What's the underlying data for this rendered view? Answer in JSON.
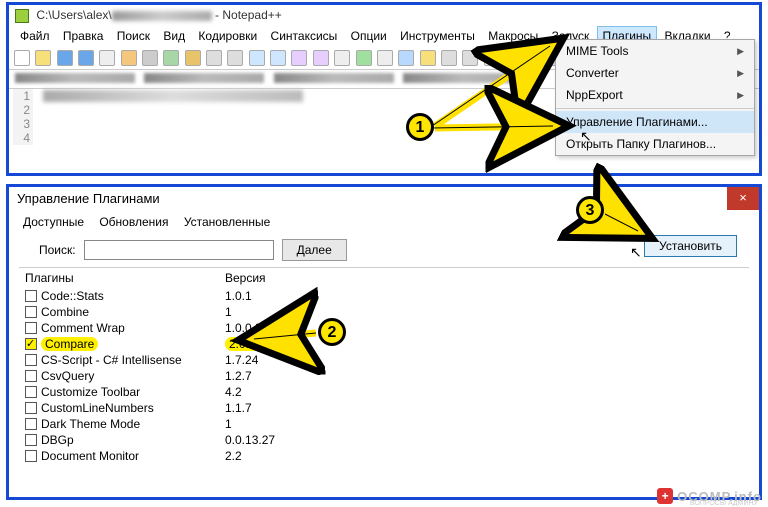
{
  "window": {
    "title_prefix": "C:\\Users\\alex\\",
    "title_suffix": " - Notepad++"
  },
  "menubar": [
    "Файл",
    "Правка",
    "Поиск",
    "Вид",
    "Кодировки",
    "Синтаксисы",
    "Опции",
    "Инструменты",
    "Макросы",
    "Запуск",
    "Плагины",
    "Вкладки",
    "?"
  ],
  "menubar_highlight_index": 10,
  "gutter_lines": [
    "1",
    "2",
    "3",
    "4"
  ],
  "dropdown": {
    "items": [
      "MIME Tools",
      "Converter",
      "NppExport"
    ],
    "sep_after": 2,
    "items2": [
      "Управление Плагинами...",
      "Открыть Папку Плагинов..."
    ],
    "highlight": "Управление Плагинами..."
  },
  "plugin_manager": {
    "title": "Управление Плагинами",
    "tabs": [
      "Доступные",
      "Обновления",
      "Установленные"
    ],
    "search_label": "Поиск:",
    "next_button": "Далее",
    "install_button": "Установить",
    "columns": [
      "Плагины",
      "Версия"
    ],
    "rows": [
      {
        "name": "Code::Stats",
        "ver": "1.0.1",
        "checked": false
      },
      {
        "name": "Combine",
        "ver": "1",
        "checked": false
      },
      {
        "name": "Comment Wrap",
        "ver": "1.0.0.3",
        "checked": false
      },
      {
        "name": "Compare",
        "ver": "2.0.1",
        "checked": true,
        "highlight": true
      },
      {
        "name": "CS-Script - C# Intellisense",
        "ver": "1.7.24",
        "checked": false
      },
      {
        "name": "CsvQuery",
        "ver": "1.2.7",
        "checked": false
      },
      {
        "name": "Customize Toolbar",
        "ver": "4.2",
        "checked": false
      },
      {
        "name": "CustomLineNumbers",
        "ver": "1.1.7",
        "checked": false
      },
      {
        "name": "Dark Theme Mode",
        "ver": "1",
        "checked": false
      },
      {
        "name": "DBGp",
        "ver": "0.0.13.27",
        "checked": false
      },
      {
        "name": "Document Monitor",
        "ver": "2.2",
        "checked": false
      }
    ]
  },
  "badges": {
    "b1": "1",
    "b2": "2",
    "b3": "3"
  },
  "watermark": {
    "plus": "+",
    "text": "OCOMP.info",
    "sub": "ВОПРОСЫ АДМИНУ"
  }
}
